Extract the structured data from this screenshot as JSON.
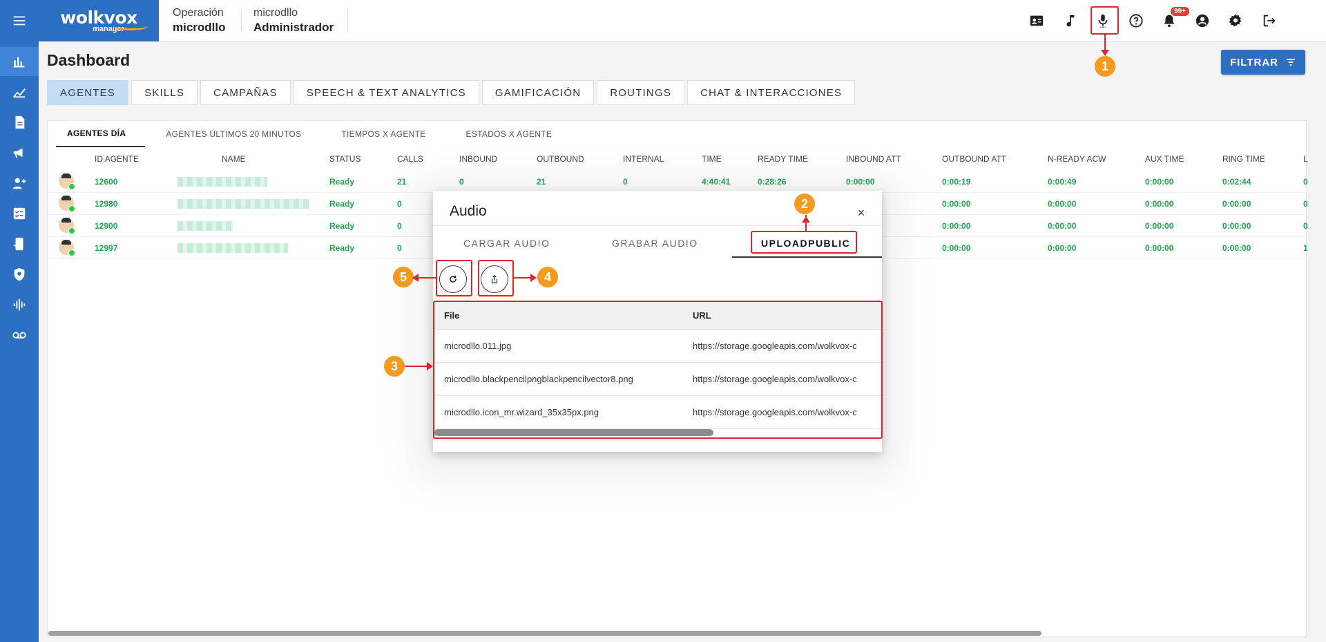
{
  "app": {
    "logo_word": "wolkvox",
    "logo_sub": "manager"
  },
  "context": [
    {
      "label": "Operación",
      "value": "microdllo"
    },
    {
      "label": "microdllo",
      "value": "Administrador"
    }
  ],
  "topbar_icons": [
    "contact-card-icon",
    "music-note-icon",
    "microphone-icon",
    "help-icon",
    "bell-icon",
    "account-icon",
    "gear-icon",
    "logout-icon"
  ],
  "notifications": {
    "badge": "99+"
  },
  "sidebar_icons": [
    "menu-icon",
    "bar-chart-icon",
    "trend-chart-icon",
    "document-icon",
    "megaphone-icon",
    "add-user-icon",
    "checklist-icon",
    "phone-settings-icon",
    "shield-search-icon",
    "waveform-icon",
    "voicemail-icon"
  ],
  "page": {
    "title": "Dashboard",
    "filter_label": "FILTRAR"
  },
  "main_tabs": [
    "AGENTES",
    "SKILLS",
    "CAMPAÑAS",
    "SPEECH & TEXT ANALYTICS",
    "GAMIFICACIÓN",
    "ROUTINGS",
    "CHAT & INTERACCIONES"
  ],
  "sub_tabs": [
    "AGENTES DÍA",
    "AGENTES ÚLTIMOS 20 MINUTOS",
    "TIEMPOS X AGENTE",
    "ESTADOS X AGENTE"
  ],
  "grid": {
    "columns": [
      "ID AGENTE",
      "NAME",
      "STATUS",
      "CALLS",
      "INBOUND",
      "OUTBOUND",
      "INTERNAL",
      "TIME",
      "READY TIME",
      "INBOUND ATT",
      "OUTBOUND ATT",
      "N-READY ACW",
      "AUX TIME",
      "RING TIME",
      "L"
    ],
    "rows": [
      {
        "id": "12600",
        "status": "Ready",
        "calls": "21",
        "inbound": "0",
        "outbound": "21",
        "internal": "0",
        "time": "4:40:41",
        "ready_time": "0:28:26",
        "inbound_att": "0:00:00",
        "outbound_att": "0:00:19",
        "nready_acw": "0:00:49",
        "aux_time": "0:00:00",
        "ring_time": "0:02:44",
        "last": "0"
      },
      {
        "id": "12980",
        "status": "Ready",
        "calls": "0",
        "outbound_att": "0:00:00",
        "nready_acw": "0:00:00",
        "aux_time": "0:00:00",
        "ring_time": "0:00:00",
        "last": "0"
      },
      {
        "id": "12900",
        "status": "Ready",
        "calls": "0",
        "outbound_att": "0:00:00",
        "nready_acw": "0:00:00",
        "aux_time": "0:00:00",
        "ring_time": "0:00:00",
        "last": "0"
      },
      {
        "id": "12997",
        "status": "Ready",
        "calls": "0",
        "outbound_att": "0:00:00",
        "nready_acw": "0:00:00",
        "aux_time": "0:00:00",
        "ring_time": "0:00:00",
        "last": "1"
      }
    ]
  },
  "dialog": {
    "title": "Audio",
    "close": "×",
    "tabs": [
      "CARGAR AUDIO",
      "GRABAR AUDIO",
      "UPLOADPUBLIC"
    ],
    "columns": [
      "File",
      "URL"
    ],
    "files": [
      {
        "file": "microdllo.011.jpg",
        "url": "https://storage.googleapis.com/wolkvox-c"
      },
      {
        "file": "microdllo.blackpencilpngblackpencilvector8.png",
        "url": "https://storage.googleapis.com/wolkvox-c"
      },
      {
        "file": "microdllo.icon_mr.wizard_35x35px.png",
        "url": "https://storage.googleapis.com/wolkvox-c"
      }
    ]
  },
  "markers": [
    "1",
    "2",
    "3",
    "4",
    "5"
  ],
  "colors": {
    "brand": "#2d6fc0",
    "active_tab": "#c4dcf3",
    "ready_green": "#1fa64a",
    "annotation_red": "#e0222c",
    "marker_orange": "#f39a1f"
  }
}
